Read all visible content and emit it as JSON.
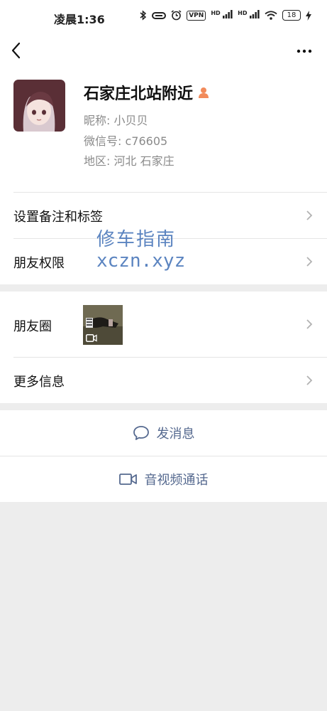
{
  "status_bar": {
    "time": "凌晨1:36",
    "vpn": "VPN",
    "hd1": "HD",
    "hd2": "HD",
    "battery": "18"
  },
  "profile": {
    "name": "石家庄北站附近",
    "nickname": "昵称:  小贝贝",
    "wechat_id": "微信号:  c76605",
    "region": "地区:  河北   石家庄",
    "gender_color": "#f28b5b"
  },
  "menu": {
    "remark_tags": "设置备注和标签",
    "permissions": "朋友权限",
    "moments": "朋友圈",
    "more_info": "更多信息"
  },
  "watermark": {
    "line1": "修车指南",
    "line2": "xczn.xyz"
  },
  "actions": {
    "message": "发消息",
    "call": "音视频通话"
  },
  "colors": {
    "accent": "#55698f",
    "background": "#ededed",
    "battery_green": "#6bd36b"
  }
}
